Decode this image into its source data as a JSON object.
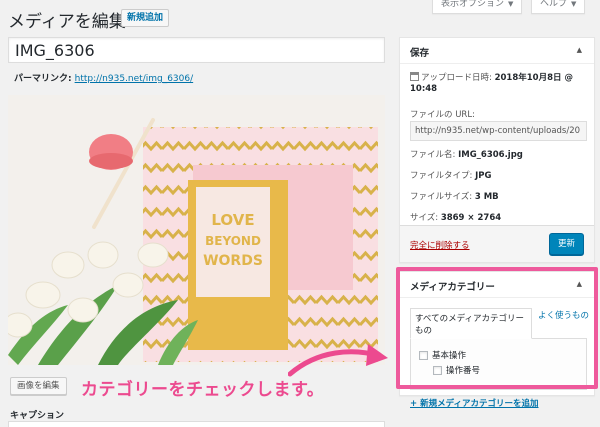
{
  "header": {
    "title": "メディアを編集",
    "add_new": "新規追加",
    "screen_options": "表示オプション",
    "help": "ヘルプ",
    "dropdown_icon": "▼"
  },
  "media": {
    "title_value": "IMG_6306",
    "permalink_label": "パーマリンク:",
    "permalink_url": "http://n935.net/img_6306/",
    "image_text": [
      "LOVE",
      "BEYOND",
      "WORDS"
    ],
    "edit_image_button": "画像を編集",
    "caption_label": "キャプション"
  },
  "annotation": {
    "text": "カテゴリーをチェックします。",
    "color": "#ec4a8f"
  },
  "save_box": {
    "title": "保存",
    "toggle_icon": "▲",
    "upload_date_label": "アップロード日時:",
    "upload_date_value": "2018年10月8日 @",
    "upload_time": "10:48",
    "file_url_label": "ファイルの URL:",
    "file_url": "http://n935.net/wp-content/uploads/20",
    "file_name_label": "ファイル名:",
    "file_name": "IMG_6306.jpg",
    "file_type_label": "ファイルタイプ:",
    "file_type": "JPG",
    "file_size_label": "ファイルサイズ:",
    "file_size": "3 MB",
    "dimensions_label": "サイズ:",
    "dimensions": "3869 × 2764",
    "delete_link": "完全に削除する",
    "update_button": "更新"
  },
  "category_box": {
    "title": "メディアカテゴリー",
    "toggle_icon": "▲",
    "tab_all": "すべてのメディアカテゴリーもの",
    "tab_popular": "よく使うもの",
    "categories": [
      {
        "label": "基本操作",
        "checked": false
      },
      {
        "label": "操作番号",
        "checked": false
      }
    ],
    "add_new_link": "+ 新規メディアカテゴリーを追加"
  },
  "colors": {
    "highlight": "#ee5a9c",
    "link": "#0073aa",
    "primary_button": "#0085ba",
    "delete": "#aa0000"
  }
}
